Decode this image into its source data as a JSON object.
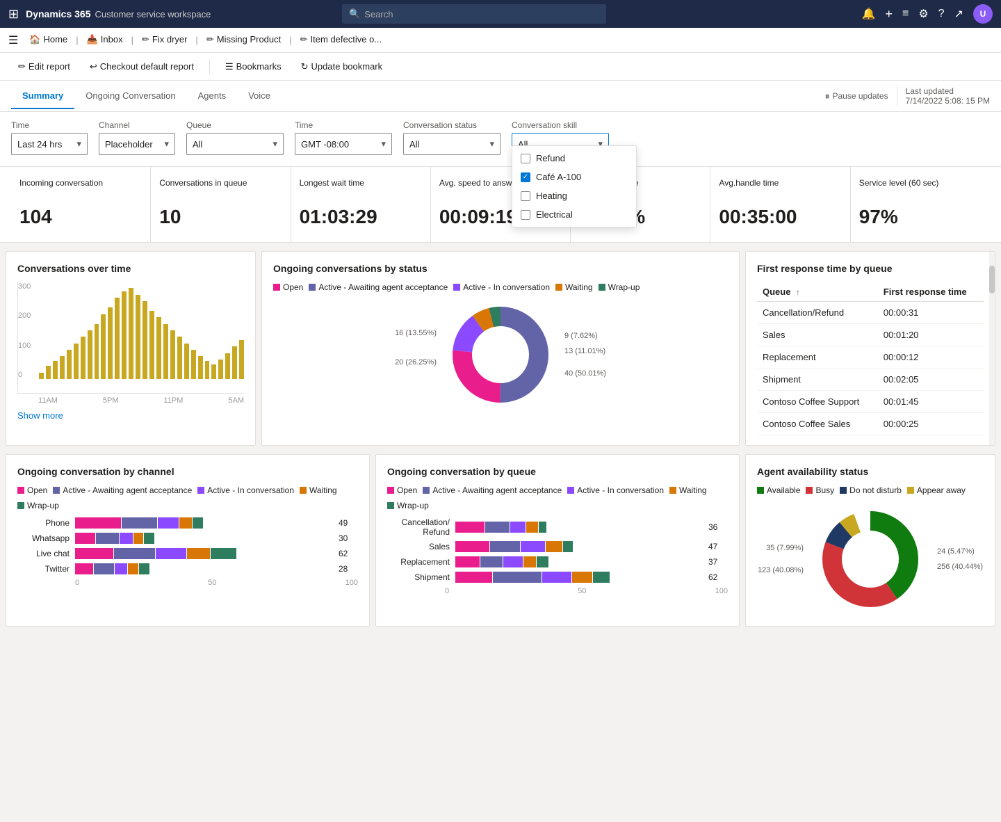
{
  "app": {
    "waffle": "⊞",
    "brand": "Dynamics 365",
    "workspace": "Customer service workspace",
    "search_placeholder": "Search"
  },
  "nav_icons": [
    "🔔",
    "+",
    "≡",
    "⚙",
    "?",
    "↗"
  ],
  "avatar_initials": "U",
  "breadcrumbs": [
    {
      "label": "Home",
      "icon": "🏠",
      "active": false
    },
    {
      "label": "Inbox",
      "icon": "📥",
      "active": false
    },
    {
      "label": "Fix dryer",
      "icon": "✏",
      "active": false
    },
    {
      "label": "Missing Product",
      "icon": "✏",
      "active": false
    },
    {
      "label": "Item defective o...",
      "icon": "✏",
      "active": false
    }
  ],
  "actions": [
    {
      "label": "Edit report",
      "icon": "✏"
    },
    {
      "label": "Checkout default report",
      "icon": "↩"
    },
    {
      "label": "Bookmarks",
      "icon": "☰"
    },
    {
      "label": "Update bookmark",
      "icon": "↻"
    }
  ],
  "tabs": [
    {
      "label": "Summary",
      "active": true
    },
    {
      "label": "Ongoing Conversation",
      "active": false
    },
    {
      "label": "Agents",
      "active": false
    },
    {
      "label": "Voice",
      "active": false
    }
  ],
  "header_right": {
    "pause_label": "Pause updates",
    "last_updated_label": "Last updated",
    "last_updated_value": "7/14/2022 5:08: 15 PM"
  },
  "filters": {
    "time": {
      "label": "Time",
      "value": "Last 24 hrs"
    },
    "channel": {
      "label": "Channel",
      "value": "Placeholder"
    },
    "queue": {
      "label": "Queue",
      "value": "All"
    },
    "time2": {
      "label": "Time",
      "value": "GMT -08:00"
    },
    "conversation_status": {
      "label": "Conversation status",
      "value": "All"
    },
    "conversation_skill": {
      "label": "Conversation skill",
      "value": "All",
      "options": [
        {
          "label": "Refund",
          "checked": false
        },
        {
          "label": "Café A-100",
          "checked": true
        },
        {
          "label": "Heating",
          "checked": false
        },
        {
          "label": "Electrical",
          "checked": false
        }
      ]
    }
  },
  "kpis": [
    {
      "label": "Incoming conversation",
      "value": "104"
    },
    {
      "label": "Conversations in queue",
      "value": "10"
    },
    {
      "label": "Longest wait time",
      "value": "01:03:29"
    },
    {
      "label": "Avg. speed to answer",
      "value": "00:09:19"
    },
    {
      "label": "Abandoned rate",
      "value": "12.55%"
    },
    {
      "label": "Avg.handle time",
      "value": "00:35:00"
    },
    {
      "label": "Service level (60 sec)",
      "value": "97%"
    }
  ],
  "conversations_over_time": {
    "title": "Conversations over time",
    "show_more": "Show more",
    "y_labels": [
      "300",
      "200",
      "100",
      "0"
    ],
    "x_labels": [
      "11AM",
      "5PM",
      "11PM",
      "5AM"
    ],
    "bars": [
      20,
      40,
      55,
      70,
      90,
      110,
      130,
      150,
      170,
      200,
      220,
      250,
      270,
      280,
      260,
      240,
      210,
      190,
      170,
      150,
      130,
      110,
      90,
      70,
      55,
      45,
      60,
      80,
      100,
      120
    ]
  },
  "ongoing_by_status": {
    "title": "Ongoing conversations by status",
    "legend": [
      {
        "label": "Open",
        "color": "#e91e8c"
      },
      {
        "label": "Active - Awaiting agent acceptance",
        "color": "#6264a7"
      },
      {
        "label": "Active - In conversation",
        "color": "#8b4aff"
      },
      {
        "label": "Waiting",
        "color": "#d97706"
      },
      {
        "label": "Wrap-up",
        "color": "#2e7d5e"
      }
    ],
    "segments": [
      {
        "label": "40 (50.01%)",
        "value": 50.01,
        "color": "#6264a7"
      },
      {
        "label": "20 (26.25%)",
        "value": 26.25,
        "color": "#e91e8c"
      },
      {
        "label": "16 (13.55%)",
        "value": 13.55,
        "color": "#8b4aff"
      },
      {
        "label": "13 (11.01%)",
        "value": 11.01,
        "color": "#d97706"
      },
      {
        "label": "9 (7.62%)",
        "value": 7.62,
        "color": "#2e7d5e"
      }
    ],
    "side_labels": [
      {
        "text": "9 (7.62%)",
        "pos": "top-right"
      },
      {
        "text": "13 (11.01%)",
        "pos": "right"
      },
      {
        "text": "16 (13.55%)",
        "pos": "left"
      },
      {
        "text": "20 (26.25%)",
        "pos": "bottom-left"
      },
      {
        "text": "40 (50.01%)",
        "pos": "right-mid"
      }
    ]
  },
  "first_response": {
    "title": "First response time by queue",
    "col_queue": "Queue",
    "col_time": "First response time",
    "rows": [
      {
        "queue": "Cancellation/Refund",
        "time": "00:00:31"
      },
      {
        "queue": "Sales",
        "time": "00:01:20"
      },
      {
        "queue": "Replacement",
        "time": "00:00:12"
      },
      {
        "queue": "Shipment",
        "time": "00:02:05"
      },
      {
        "queue": "Contoso Coffee Support",
        "time": "00:01:45"
      },
      {
        "queue": "Contoso Coffee Sales",
        "time": "00:00:25"
      }
    ]
  },
  "ongoing_by_channel": {
    "title": "Ongoing conversation by channel",
    "legend": [
      {
        "label": "Open",
        "color": "#e91e8c"
      },
      {
        "label": "Active - Awaiting agent acceptance",
        "color": "#6264a7"
      },
      {
        "label": "Active - In conversation",
        "color": "#8b4aff"
      },
      {
        "label": "Waiting",
        "color": "#d97706"
      },
      {
        "label": "Wrap-up",
        "color": "#2e7d5e"
      }
    ],
    "rows": [
      {
        "label": "Phone",
        "segments": [
          18,
          14,
          8,
          5,
          4
        ],
        "total": 49
      },
      {
        "label": "Whatsapp",
        "segments": [
          8,
          9,
          5,
          4,
          4
        ],
        "total": 30
      },
      {
        "label": "Live chat",
        "segments": [
          15,
          16,
          12,
          9,
          10
        ],
        "total": 62
      },
      {
        "label": "Twitter",
        "segments": [
          7,
          8,
          5,
          4,
          4
        ],
        "total": 28
      }
    ],
    "x_axis": [
      "0",
      "50",
      "100"
    ]
  },
  "ongoing_by_queue": {
    "title": "Ongoing conversation by queue",
    "legend": [
      {
        "label": "Open",
        "color": "#e91e8c"
      },
      {
        "label": "Active - Awaiting agent acceptance",
        "color": "#6264a7"
      },
      {
        "label": "Active - In conversation",
        "color": "#8b4aff"
      },
      {
        "label": "Waiting",
        "color": "#d97706"
      },
      {
        "label": "Wrap-up",
        "color": "#2e7d5e"
      }
    ],
    "rows": [
      {
        "label": "Cancellation/ Refund",
        "segments": [
          12,
          10,
          6,
          5,
          3
        ],
        "total": 36
      },
      {
        "label": "Sales",
        "segments": [
          14,
          12,
          10,
          7,
          4
        ],
        "total": 47
      },
      {
        "label": "Replacement",
        "segments": [
          10,
          9,
          8,
          5,
          5
        ],
        "total": 37
      },
      {
        "label": "Shipment",
        "segments": [
          15,
          20,
          12,
          8,
          7
        ],
        "total": 62
      }
    ],
    "x_axis": [
      "0",
      "50",
      "100"
    ]
  },
  "agent_availability": {
    "title": "Agent availability status",
    "legend": [
      {
        "label": "Available",
        "color": "#107c10"
      },
      {
        "label": "Busy",
        "color": "#d13438"
      },
      {
        "label": "Do not disturb",
        "color": "#1f3864"
      },
      {
        "label": "Appear away",
        "color": "#c8a820"
      }
    ],
    "segments": [
      {
        "label": "256 (40.44%)",
        "value": 40.44,
        "color": "#107c10"
      },
      {
        "label": "123 (40.08%)",
        "value": 40.08,
        "color": "#d13438"
      },
      {
        "label": "35 (7.99%)",
        "value": 7.99,
        "color": "#1f3864"
      },
      {
        "label": "24 (5.47%)",
        "value": 5.47,
        "color": "#c8a820"
      }
    ],
    "side_labels": [
      {
        "text": "24 (5.47%)",
        "side": "right-top"
      },
      {
        "text": "35 (7.99%)",
        "side": "left-top"
      },
      {
        "text": "256 (40.44%)",
        "side": "right-mid"
      },
      {
        "text": "123 (40.08%)",
        "side": "left-bot"
      }
    ]
  },
  "colors": {
    "open": "#e91e8c",
    "active_await": "#6264a7",
    "active_conv": "#8b4aff",
    "waiting": "#d97706",
    "wrapup": "#2e7d5e",
    "available": "#107c10",
    "busy": "#d13438",
    "dnd": "#1f3864",
    "appear_away": "#c8a820"
  }
}
